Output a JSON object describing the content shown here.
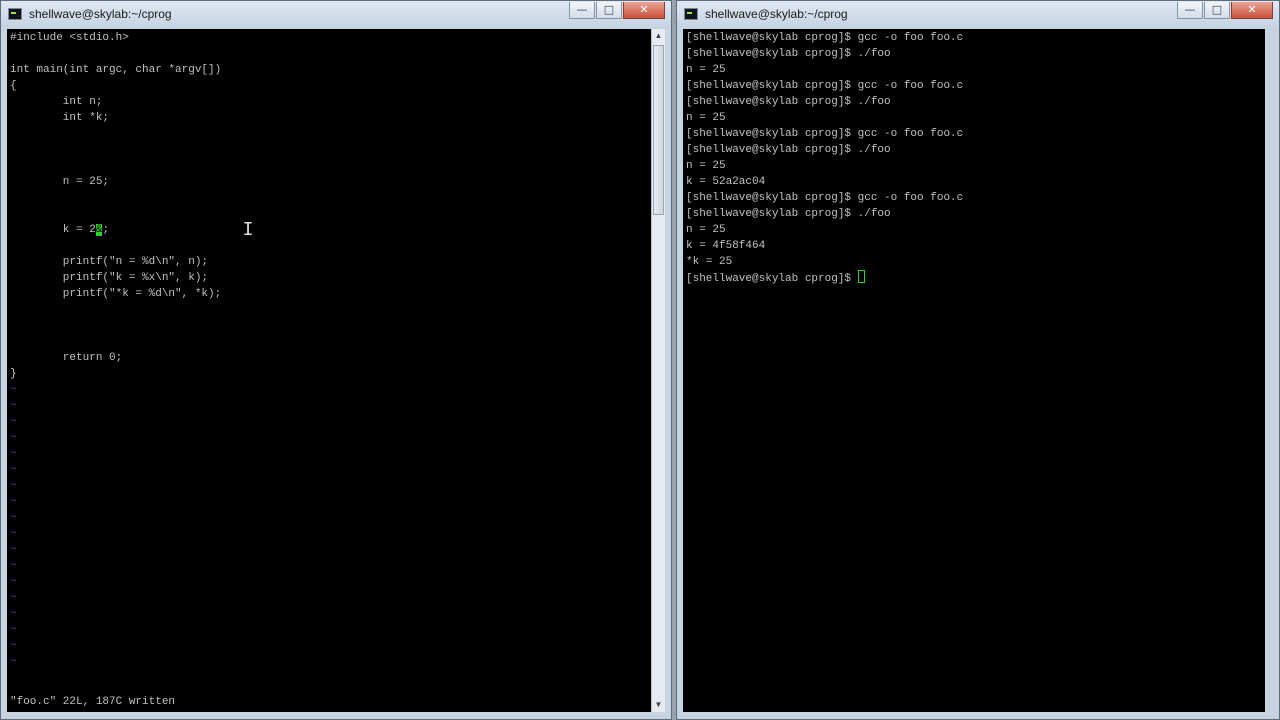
{
  "editor_window": {
    "title": "shellwave@skylab:~/cprog",
    "buttons": {
      "minimize": "—",
      "maximize": "□",
      "close": "✕"
    },
    "code_lines": [
      "#include <stdio.h>",
      "",
      "int main(int argc, char *argv[])",
      "{",
      "        int n;",
      "        int *k;",
      "",
      "",
      "",
      "        n = 25;",
      "",
      "",
      "        k = 2",
      "",
      "        printf(\"n = %d\\n\", n);",
      "        printf(\"k = %x\\n\", k);",
      "        printf(\"*k = %d\\n\", *k);",
      "",
      "",
      "",
      "        return 0;",
      "}"
    ],
    "cursor_line_prefix": "        k = 2",
    "cursor_char": "&",
    "cursor_line_suffix": ";",
    "tilde_char": "~",
    "tilde_count": 18,
    "status_line": "\"foo.c\" 22L, 187C written"
  },
  "shell_window": {
    "title": "shellwave@skylab:~/cprog",
    "buttons": {
      "minimize": "—",
      "maximize": "□",
      "close": "✕"
    },
    "lines": [
      "[shellwave@skylab cprog]$ gcc -o foo foo.c",
      "[shellwave@skylab cprog]$ ./foo",
      "n = 25",
      "[shellwave@skylab cprog]$ gcc -o foo foo.c",
      "[shellwave@skylab cprog]$ ./foo",
      "n = 25",
      "[shellwave@skylab cprog]$ gcc -o foo foo.c",
      "[shellwave@skylab cprog]$ ./foo",
      "n = 25",
      "k = 52a2ac04",
      "[shellwave@skylab cprog]$ gcc -o foo foo.c",
      "[shellwave@skylab cprog]$ ./foo",
      "n = 25",
      "k = 4f58f464",
      "*k = 25"
    ],
    "prompt": "[shellwave@skylab cprog]$ "
  },
  "colors": {
    "terminal_bg": "#000000",
    "terminal_text": "#c0c0c0",
    "cursor": "#2bd429",
    "vim_tilde": "#3b3bbf"
  }
}
